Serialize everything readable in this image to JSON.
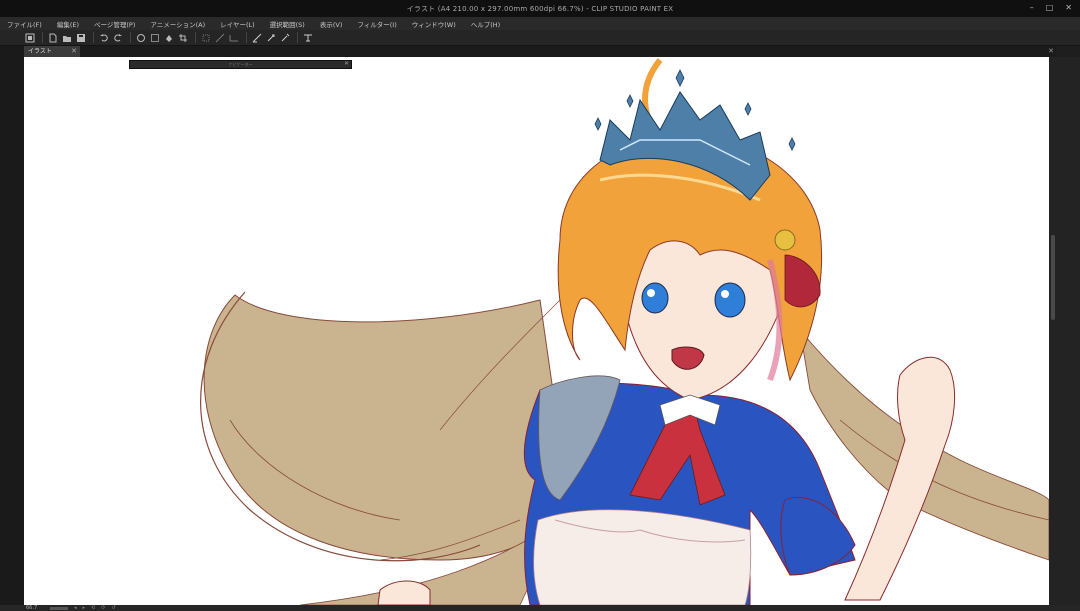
{
  "window": {
    "title": "イラスト (A4 210.00 x 297.00mm 600dpi 66.7%) - CLIP STUDIO PAINT EX",
    "controls": [
      "–",
      "□",
      "✕"
    ]
  },
  "menu": [
    {
      "label": "ファイル(F)"
    },
    {
      "label": "編集(E)"
    },
    {
      "label": "ページ管理(P)"
    },
    {
      "label": "アニメーション(A)"
    },
    {
      "label": "レイヤー(L)"
    },
    {
      "label": "選択範囲(S)"
    },
    {
      "label": "表示(V)"
    },
    {
      "label": "フィルター(I)"
    },
    {
      "label": "ウィンドウ(W)"
    },
    {
      "label": "ヘルプ(H)"
    }
  ],
  "toolbar": {
    "icons": [
      "clip-studio-icon",
      "new-file-icon",
      "open-file-icon",
      "save-file-icon",
      "undo-icon",
      "redo-icon",
      "clear-icon",
      "clear-outside-icon",
      "fill-icon",
      "crop-icon",
      "transform-icon",
      "snap-special-icon",
      "snap-ruler-icon",
      "snap-grid-icon",
      "ruler-icon",
      "pen-settings-icon",
      "brush-settings-icon",
      "layout-dropdown-icon"
    ]
  },
  "document_tab": {
    "label": "イラスト",
    "close": "✕"
  },
  "tab_area_close": "✕",
  "nav_panel": {
    "title": "ナビゲーター",
    "close": "✕"
  },
  "status": {
    "zoom": "66.7",
    "controls": [
      "◂",
      "▸",
      "⟲",
      "⟳",
      "↺"
    ]
  },
  "colors": {
    "titlebar": "#101010",
    "menubar": "#2a2a2a",
    "toolbar": "#252525",
    "canvas": "#ffffff",
    "hair_orange": "#f0a03a",
    "hair_long": "#c8b38f",
    "dress_blue": "#2a55c0",
    "ribbon_red": "#c9313f",
    "crown_blue": "#4d7fa8",
    "skin": "#fbe6da"
  }
}
